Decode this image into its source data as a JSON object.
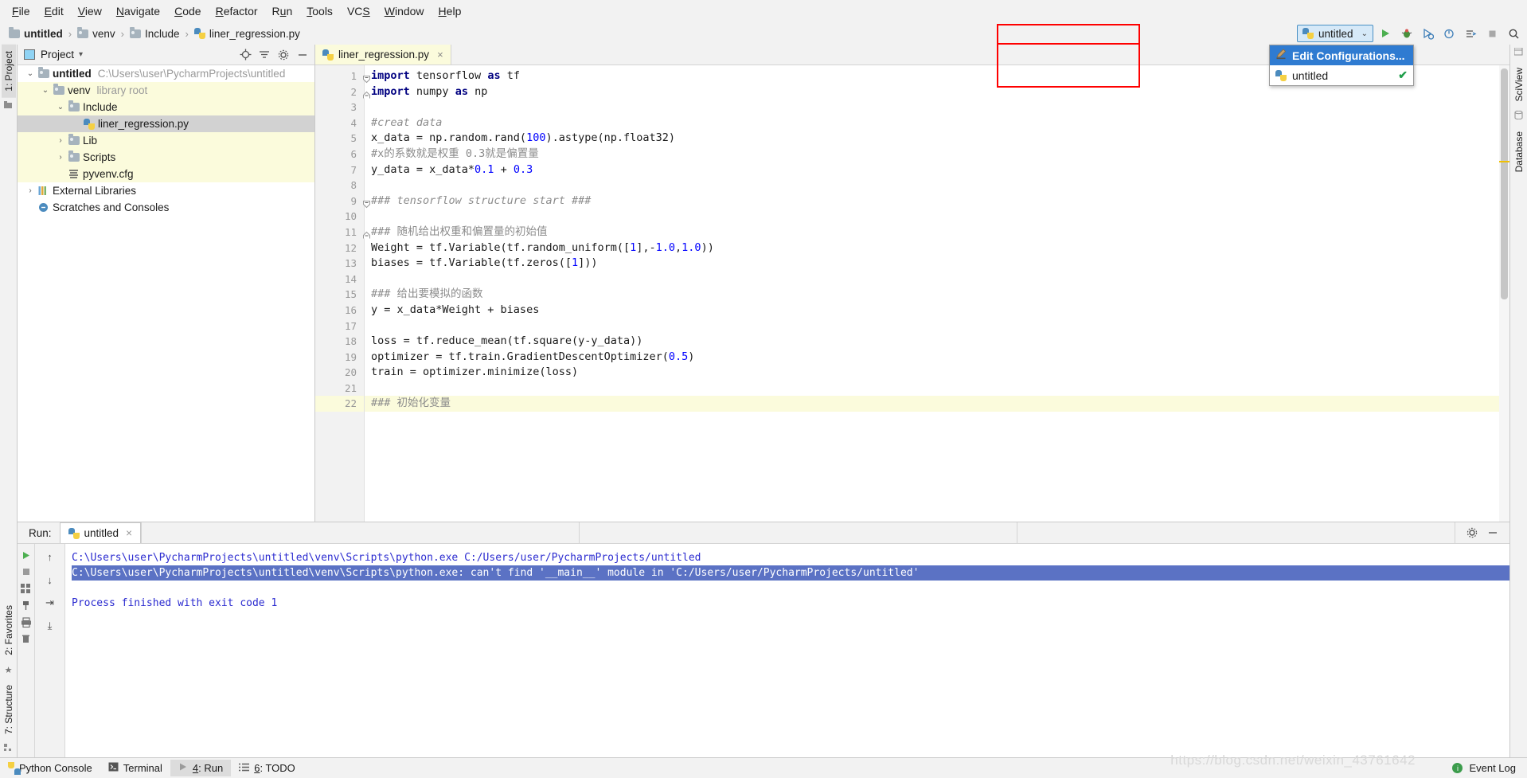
{
  "menubar": {
    "items": [
      {
        "label": "File",
        "accel": "F"
      },
      {
        "label": "Edit",
        "accel": "E"
      },
      {
        "label": "View",
        "accel": "V"
      },
      {
        "label": "Navigate",
        "accel": "N"
      },
      {
        "label": "Code",
        "accel": "C"
      },
      {
        "label": "Refactor",
        "accel": "R"
      },
      {
        "label": "Run",
        "accel": "u"
      },
      {
        "label": "Tools",
        "accel": "T"
      },
      {
        "label": "VCS",
        "accel": "S"
      },
      {
        "label": "Window",
        "accel": "W"
      },
      {
        "label": "Help",
        "accel": "H"
      }
    ]
  },
  "breadcrumb": {
    "items": [
      "untitled",
      "venv",
      "Include",
      "liner_regression.py"
    ],
    "separator": "›"
  },
  "toolbar": {
    "run_config_name": "untitled",
    "chevron": "⌄",
    "run_icon": "▶",
    "debug_icon": "🐞",
    "coverage_icon": "⬡",
    "profile_icon": "◔",
    "attach_icon": "⇥",
    "stop_icon": "■",
    "search_icon": "🔍"
  },
  "run_dropdown": {
    "visible": true,
    "items": [
      {
        "label": "Edit Configurations...",
        "selected": true,
        "icon": "pencil",
        "checked": false
      },
      {
        "label": "untitled",
        "selected": false,
        "icon": "python",
        "checked": true
      }
    ],
    "check_glyph": "✔"
  },
  "left_strip": {
    "label": "1: Project",
    "structure_label": "7: Structure",
    "favorites_label": "2: Favorites"
  },
  "right_strip": {
    "items": [
      "SciView",
      "Database"
    ]
  },
  "project_panel": {
    "title": "Project",
    "chevron": "▾",
    "icons": [
      "locate-icon",
      "collapse-icon",
      "settings-icon",
      "hide-icon"
    ],
    "tree": [
      {
        "indent": 0,
        "twisty": "⌄",
        "icon": "folder-open",
        "label": "untitled",
        "bold": true,
        "note": "C:\\Users\\user\\PycharmProjects\\untitled",
        "highlight": "none"
      },
      {
        "indent": 1,
        "twisty": "⌄",
        "icon": "folder-open",
        "label": "venv",
        "bold": false,
        "note": "library root",
        "highlight": "yellow"
      },
      {
        "indent": 2,
        "twisty": "⌄",
        "icon": "folder-open",
        "label": "Include",
        "bold": false,
        "note": "",
        "highlight": "yellow"
      },
      {
        "indent": 3,
        "twisty": "",
        "icon": "python",
        "label": "liner_regression.py",
        "bold": false,
        "note": "",
        "highlight": "selected"
      },
      {
        "indent": 2,
        "twisty": "›",
        "icon": "folder",
        "label": "Lib",
        "bold": false,
        "note": "",
        "highlight": "yellow"
      },
      {
        "indent": 2,
        "twisty": "›",
        "icon": "folder",
        "label": "Scripts",
        "bold": false,
        "note": "",
        "highlight": "yellow"
      },
      {
        "indent": 2,
        "twisty": "",
        "icon": "cfg",
        "label": "pyvenv.cfg",
        "bold": false,
        "note": "",
        "highlight": "yellow"
      },
      {
        "indent": 0,
        "twisty": "›",
        "icon": "library",
        "label": "External Libraries",
        "bold": false,
        "note": "",
        "highlight": "none"
      },
      {
        "indent": 0,
        "twisty": "",
        "icon": "scratch",
        "label": "Scratches and Consoles",
        "bold": false,
        "note": "",
        "highlight": "none"
      }
    ]
  },
  "editor": {
    "tab_label": "liner_regression.py",
    "tab_close": "×",
    "current_line": 22,
    "lines": [
      {
        "n": 1,
        "fold": "down",
        "text": "import tensorflow as tf"
      },
      {
        "n": 2,
        "fold": "end",
        "text": "import numpy as np"
      },
      {
        "n": 3,
        "fold": "",
        "text": ""
      },
      {
        "n": 4,
        "fold": "",
        "text": "#creat data"
      },
      {
        "n": 5,
        "fold": "",
        "text": "x_data = np.random.rand(100).astype(np.float32)"
      },
      {
        "n": 6,
        "fold": "",
        "text": "#x的系数就是权重 0.3就是偏置量"
      },
      {
        "n": 7,
        "fold": "",
        "text": "y_data = x_data*0.1 + 0.3"
      },
      {
        "n": 8,
        "fold": "",
        "text": ""
      },
      {
        "n": 9,
        "fold": "down",
        "text": "### tensorflow structure start ###"
      },
      {
        "n": 10,
        "fold": "",
        "text": ""
      },
      {
        "n": 11,
        "fold": "end",
        "text": "### 随机给出权重和偏置量的初始值"
      },
      {
        "n": 12,
        "fold": "",
        "text": "Weight = tf.Variable(tf.random_uniform([1],-1.0,1.0))"
      },
      {
        "n": 13,
        "fold": "",
        "text": "biases = tf.Variable(tf.zeros([1]))"
      },
      {
        "n": 14,
        "fold": "",
        "text": ""
      },
      {
        "n": 15,
        "fold": "",
        "text": "### 给出要模拟的函数"
      },
      {
        "n": 16,
        "fold": "",
        "text": "y = x_data*Weight + biases"
      },
      {
        "n": 17,
        "fold": "",
        "text": ""
      },
      {
        "n": 18,
        "fold": "",
        "text": "loss = tf.reduce_mean(tf.square(y-y_data))"
      },
      {
        "n": 19,
        "fold": "",
        "text": "optimizer = tf.train.GradientDescentOptimizer(0.5)"
      },
      {
        "n": 20,
        "fold": "",
        "text": "train = optimizer.minimize(loss)"
      },
      {
        "n": 21,
        "fold": "",
        "text": ""
      },
      {
        "n": 22,
        "fold": "",
        "text": "### 初始化变量"
      }
    ]
  },
  "run_panel": {
    "label": "Run:",
    "tab_label": "untitled",
    "tab_close": "×",
    "settings_icon": "⚙",
    "minimize_icon": "−",
    "gutter_buttons": [
      "▶",
      "■",
      "☰",
      "⚑",
      "🖨",
      "🗑"
    ],
    "side_buttons": [
      "↑",
      "↓",
      "↲",
      "⤓"
    ],
    "console_lines": [
      {
        "text": "C:\\Users\\user\\PycharmProjects\\untitled\\venv\\Scripts\\python.exe C:/Users/user/PycharmProjects/untitled",
        "selected": false
      },
      {
        "text": "C:\\Users\\user\\PycharmProjects\\untitled\\venv\\Scripts\\python.exe: can't find '__main__' module in 'C:/Users/user/PycharmProjects/untitled'",
        "selected": true
      },
      {
        "text": "",
        "selected": false
      },
      {
        "text": "Process finished with exit code 1",
        "selected": false
      }
    ]
  },
  "statusbar": {
    "items": [
      {
        "label": "Python Console",
        "icon": "python-icon",
        "active": false
      },
      {
        "label": "Terminal",
        "icon": "terminal-icon",
        "active": false
      },
      {
        "label": "4: Run",
        "icon": "run-icon",
        "active": true,
        "accel": "4"
      },
      {
        "label": "6: TODO",
        "icon": "todo-icon",
        "active": false,
        "accel": "6"
      }
    ],
    "event_log": "Event Log",
    "event_badge": "i"
  },
  "watermark": "https://blog.csdn.net/weixin_43761642",
  "colors": {
    "accent_blue": "#2f7bd1",
    "highlight_yellow": "#fbfbdc",
    "selection_gray": "#d2d2d2",
    "console_blue": "#2b2bd0",
    "console_sel": "#5b72c4",
    "red_box": "#ff0000",
    "keyword": "#000080",
    "comment": "#8c8c8c",
    "number": "#0000ff",
    "green": "#3c9c4c"
  }
}
